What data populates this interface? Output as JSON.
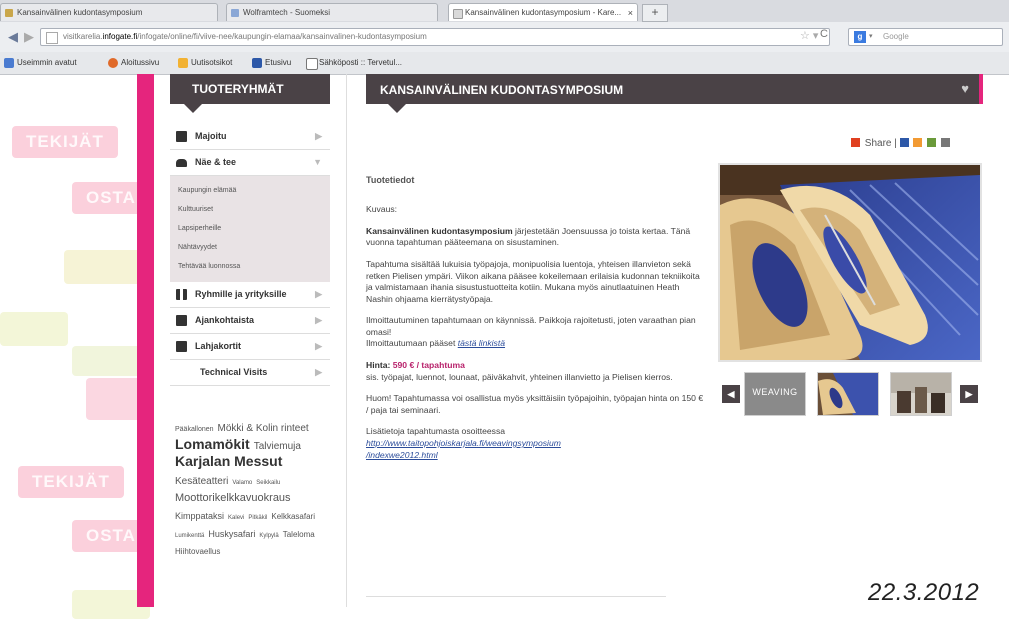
{
  "browser": {
    "tabs": [
      {
        "label": "Kansainvälinen kudontasymposium"
      },
      {
        "label": "Wolframtech - Suomeksi"
      },
      {
        "label": "Kansainvälinen kudontasymposium - Kare..."
      }
    ],
    "url_prefix": "visitkarelia.",
    "url_domain": "infogate.fi",
    "url_rest": "/infogate/online/fi/viive-nee/kaupungin-elamaa/kansainvalinen-kudontasymposium",
    "search_placeholder": "Google",
    "bookmarks": [
      "Useimmin avatut",
      "Aloitussivu",
      "Uutisotsikot",
      "Etusivu",
      "Sähköposti :: Tervetul..."
    ]
  },
  "background_ghosts": [
    "TEKIJÄT",
    "OSTA",
    "OSTA",
    "TEKIJÄT",
    "OSTA"
  ],
  "left": {
    "header": "TUOTERYHMÄT",
    "categories": [
      {
        "label": "Majoitu",
        "icon": "bed-icon",
        "expanded": false
      },
      {
        "label": "Näe & tee",
        "icon": "car-icon",
        "expanded": true
      },
      {
        "label": "Ryhmille ja yrityksille",
        "icon": "people-icon",
        "expanded": false
      },
      {
        "label": "Ajankohtaista",
        "icon": "calendar-icon",
        "expanded": false
      },
      {
        "label": "Lahjakortit",
        "icon": "gift-icon",
        "expanded": false
      },
      {
        "label": "Technical Visits",
        "icon": "",
        "expanded": false
      }
    ],
    "subcategories": [
      "Kaupungin elämää",
      "Kulttuuriset",
      "Lapsiperheille",
      "Nähtävyydet",
      "Tehtävää luonnossa"
    ],
    "tags": [
      {
        "text": "Pääkallonen",
        "size": 7
      },
      {
        "text": "Mökki & Kolin rinteet",
        "size": 10
      },
      {
        "text": "Lomamökit",
        "size": 14
      },
      {
        "text": "Talviemuja",
        "size": 10
      },
      {
        "text": "Karjalan Messut",
        "size": 14
      },
      {
        "text": "Kesäteatteri",
        "size": 10
      },
      {
        "text": "Valamo",
        "size": 6
      },
      {
        "text": "Seikkailu",
        "size": 6
      },
      {
        "text": "Moottorikelkkavuokraus",
        "size": 11
      },
      {
        "text": "Kimppataksi",
        "size": 9
      },
      {
        "text": "Kalevi",
        "size": 6
      },
      {
        "text": "Pitkäkil",
        "size": 6
      },
      {
        "text": "Kelkkasafari",
        "size": 8
      },
      {
        "text": "Lumikenttä",
        "size": 6
      },
      {
        "text": "Huskysafari",
        "size": 9
      },
      {
        "text": "Kylpylä",
        "size": 6
      },
      {
        "text": "Taleloma",
        "size": 8
      },
      {
        "text": "Hiihtovaellus",
        "size": 8
      }
    ]
  },
  "main": {
    "header": "KANSAINVÄLINEN KUDONTASYMPOSIUM",
    "share_label": "Share |",
    "product_info_title": "Tuotetiedot",
    "kuvaus_label": "Kuvaus:",
    "intro_bold": "Kansainvälinen kudontasymposium",
    "intro_rest": " järjestetään Joensuussa jo toista kertaa. Tänä vuonna tapahtuman pääteemana on sisustaminen.",
    "para2": "Tapahtuma sisältää lukuisia työpajoja, monipuolisia luentoja, yhteisen illanvieton sekä retken Pielisen ympäri. Viikon aikana pääsee kokeilemaan erilaisia kudonnan tekniikoita ja valmistamaan ihania sisustustuotteita kotiin. Mukana myös ainutlaatuinen Heath Nashin ohjaama kierrätystyöpaja.",
    "para3_line1": "Ilmoittautuminen tapahtumaan on käynnissä. Paikkoja rajoitetusti, joten varaathan pian omasi!",
    "para3_line2_prefix": "Ilmoittautumaan pääset ",
    "para3_link": "tästä linkistä",
    "price_label": "Hinta:",
    "price_value": "590 € / tapahtuma",
    "price_desc": "sis. työpajat, luennot, lounaat, päiväkahvit, yhteinen illanvietto ja Pielisen kierros.",
    "para5": "Huom! Tapahtumassa voi osallistua myös yksittäisiin työpajoihin, työpajan hinta on 150 € / paja tai seminaari.",
    "more_info": "Lisätietoja tapahtumasta osoitteessa",
    "more_url_1": "http://www.taitopohjoiskarjala.fi/weavingsymposium",
    "more_url_2": "/indexwe2012.html",
    "thumb1_label": "WEAVING"
  },
  "date_stamp": "22.3.2012",
  "colors": {
    "accent": "#e5257d",
    "header_dark": "#4a4246",
    "price": "#b8226b"
  }
}
